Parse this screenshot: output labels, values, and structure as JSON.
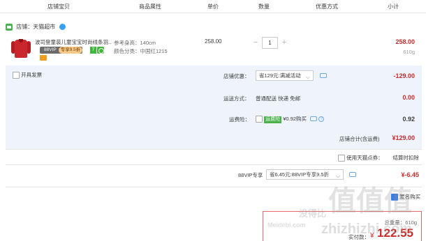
{
  "header": {
    "col_item": "店铺宝贝",
    "col_props": "商品属性",
    "col_price": "单价",
    "col_qty": "数量",
    "col_discount": "优惠方式",
    "col_subtotal": "小计"
  },
  "shop": {
    "label": "店铺：天猫超市"
  },
  "item": {
    "title": "波司登童装儿童宝宝时尚线条羽...",
    "vip_badge": "88VIP",
    "vip_discount": "专享9.5折",
    "badge_seven": "7",
    "prop_height": "参考身高：140cm",
    "prop_color": "颜色分类：中国红1215",
    "price": "258.00",
    "qty": "1",
    "qty_minus": "−",
    "qty_plus": "+",
    "subtotal": "258.00",
    "weight": "610g"
  },
  "invoice": {
    "label": "开具发票"
  },
  "shop_discount": {
    "label": "店铺优惠：",
    "value": "省129元:满减活动",
    "amount": "-129.00"
  },
  "shipping": {
    "label": "运送方式：",
    "value": "普通配送 快递 免邮",
    "amount": "0.00"
  },
  "insurance": {
    "label": "运费险：",
    "tag": "运费险",
    "value": "¥0.92购买",
    "amount": "0.92"
  },
  "shop_total": {
    "label": "店铺合计(含运费)",
    "amount": "¥129.00"
  },
  "tmall_coupon": {
    "label": "使用天猫点券：",
    "note": "结算时扣除"
  },
  "vip88": {
    "label": "88VIP专享",
    "value": "省6.45元:88VIP专享9.5折",
    "amount": "¥-6.45"
  },
  "summary": {
    "weight": "总重量：610g",
    "pay_label": "实付款：",
    "currency": "¥",
    "pay_amount": "122.55",
    "partial_label": "匿名购买"
  },
  "watermark": {
    "logo": "值值值",
    "site": "zhizhizhi.com",
    "text": "Meidebi.com",
    "cn": "没得比"
  }
}
